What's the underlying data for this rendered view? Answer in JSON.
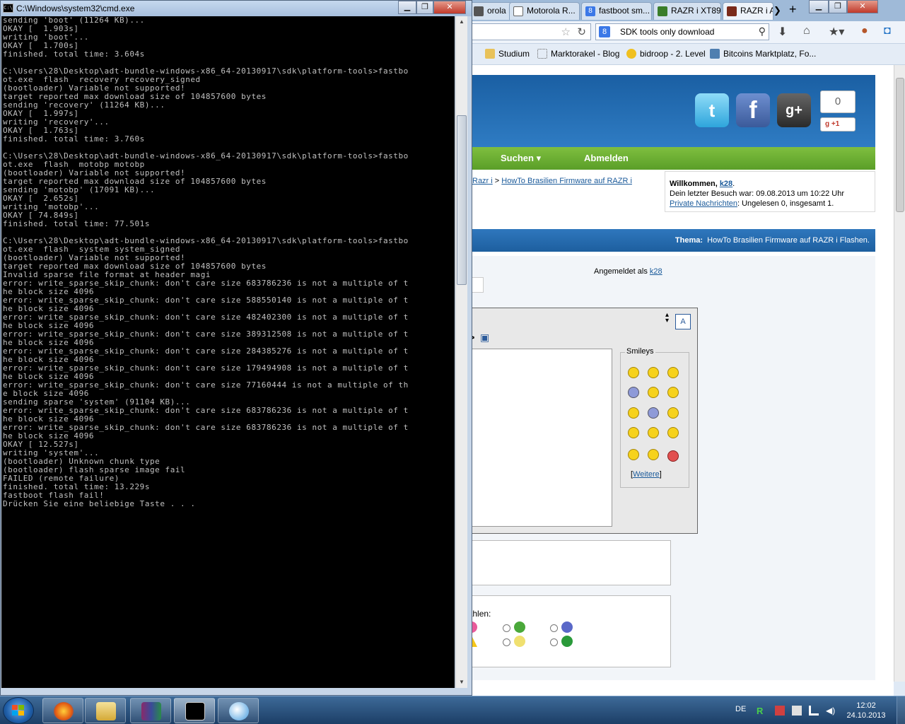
{
  "cmd": {
    "title": "C:\\Windows\\system32\\cmd.exe",
    "icon_label": "C:\\",
    "lines": [
      "sending 'boot' (11264 KB)...",
      "OKAY [  1.903s]",
      "writing 'boot'...",
      "OKAY [  1.700s]",
      "finished. total time: 3.604s",
      "",
      "C:\\Users\\28\\Desktop\\adt-bundle-windows-x86_64-20130917\\sdk\\platform-tools>fastbo",
      "ot.exe  flash  recovery recovery_signed",
      "(bootloader) Variable not supported!",
      "target reported max download size of 104857600 bytes",
      "sending 'recovery' (11264 KB)...",
      "OKAY [  1.997s]",
      "writing 'recovery'...",
      "OKAY [  1.763s]",
      "finished. total time: 3.760s",
      "",
      "C:\\Users\\28\\Desktop\\adt-bundle-windows-x86_64-20130917\\sdk\\platform-tools>fastbo",
      "ot.exe  flash  motobp motobp",
      "(bootloader) Variable not supported!",
      "target reported max download size of 104857600 bytes",
      "sending 'motobp' (17091 KB)...",
      "OKAY [  2.652s]",
      "writing 'motobp'...",
      "OKAY [ 74.849s]",
      "finished. total time: 77.501s",
      "",
      "C:\\Users\\28\\Desktop\\adt-bundle-windows-x86_64-20130917\\sdk\\platform-tools>fastbo",
      "ot.exe  flash  system system_signed",
      "(bootloader) Variable not supported!",
      "target reported max download size of 104857600 bytes",
      "Invalid sparse file format at header magi",
      "error: write_sparse_skip_chunk: don't care size 683786236 is not a multiple of t",
      "he block size 4096",
      "error: write_sparse_skip_chunk: don't care size 588550140 is not a multiple of t",
      "he block size 4096",
      "error: write_sparse_skip_chunk: don't care size 482402300 is not a multiple of t",
      "he block size 4096",
      "error: write_sparse_skip_chunk: don't care size 389312508 is not a multiple of t",
      "he block size 4096",
      "error: write_sparse_skip_chunk: don't care size 284385276 is not a multiple of t",
      "he block size 4096",
      "error: write_sparse_skip_chunk: don't care size 179494908 is not a multiple of t",
      "he block size 4096",
      "error: write_sparse_skip_chunk: don't care size 77160444 is not a multiple of th",
      "e block size 4096",
      "sending sparse 'system' (91104 KB)...",
      "error: write_sparse_skip_chunk: don't care size 683786236 is not a multiple of t",
      "he block size 4096",
      "error: write_sparse_skip_chunk: don't care size 683786236 is not a multiple of t",
      "he block size 4096",
      "OKAY [ 12.527s]",
      "writing 'system'...",
      "(bootloader) Unknown chunk type",
      "(bootloader) flash sparse image fail",
      "FAILED (remote failure)",
      "finished. total time: 13.229s",
      "fastboot flash fail!",
      "Drücken Sie eine beliebige Taste . . ."
    ]
  },
  "firefox": {
    "tabs": [
      {
        "label": "orola R...",
        "icon": "motorola-icon"
      },
      {
        "label": "Motorola R...",
        "icon": "globe-icon"
      },
      {
        "label": "fastboot sm...",
        "icon": "google-icon"
      },
      {
        "label": "RAZR i XT89...",
        "icon": "site-icon"
      },
      {
        "label": "RAZR i A",
        "icon": "xda-icon"
      }
    ],
    "tab_overflow": "❯",
    "new_tab": "+",
    "search": {
      "value": "SDK tools only download",
      "engine": "8"
    },
    "bookmarks": [
      {
        "label": "Studium"
      },
      {
        "label": "Marktorakel - Blog"
      },
      {
        "label": "bidroop - 2. Level"
      },
      {
        "label": "Bitcoins Marktplatz, Fo..."
      }
    ],
    "page": {
      "plusone_count": "0",
      "plusone_label": "+1",
      "nav": {
        "search": "Suchen ▾",
        "logout": "Abmelden"
      },
      "breadcrumb": {
        "part1": "Razr i",
        "sep": ">",
        "part2": "HowTo Brasilien Firmware auf RAZR i"
      },
      "welcome": {
        "prefix": "Willkommen,",
        "user": "k28",
        "last_visit": "Dein letzter Besuch war: 09.08.2013 um 10:22 Uhr",
        "pm_link": "Private Nachrichten",
        "pm_status": ": Ungelesen 0, insgesamt 1."
      },
      "thema": {
        "label": "Thema:",
        "title": "HowTo Brasilien Firmware auf RAZR i Flashen."
      },
      "logged_in": {
        "prefix": "Angemeldet als",
        "user": "k28"
      },
      "smileys_legend": "Smileys",
      "weitere": "Weitere",
      "icon_choose": "hricht auswählen:"
    }
  },
  "taskbar": {
    "lang": "DE",
    "time": "12:02",
    "date": "24.10.2013"
  }
}
